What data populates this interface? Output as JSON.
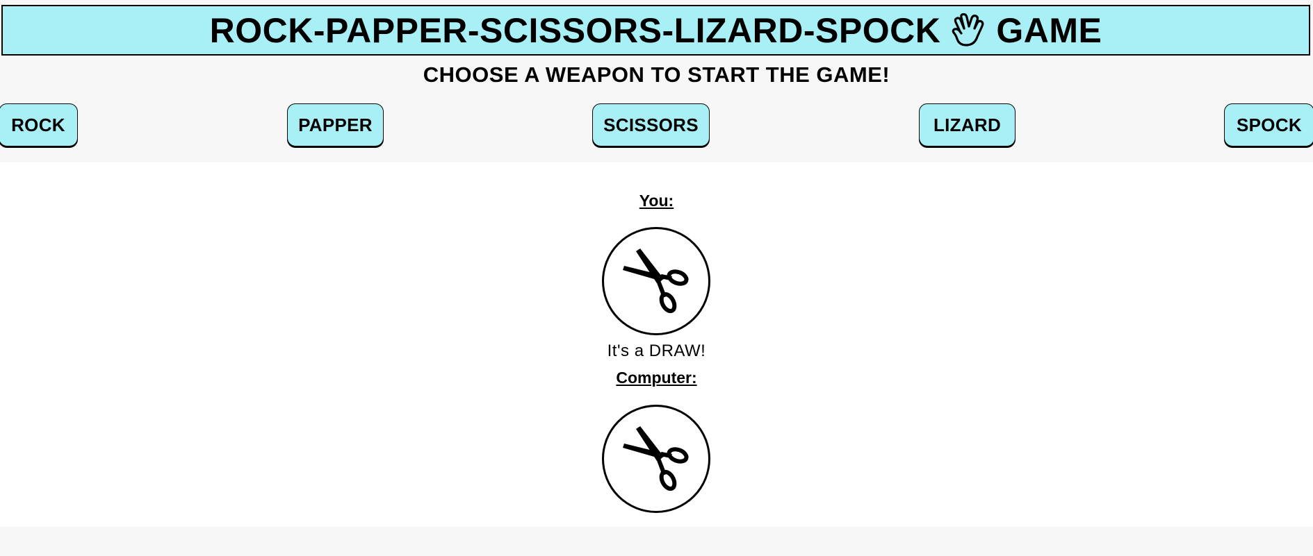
{
  "header": {
    "title": "ROCK-PAPPER-SCISSORS-LIZARD-SPOCK",
    "icon": "spock-hand-icon",
    "suffix": "GAME",
    "background": "#a8f0f5"
  },
  "subtitle": "CHOOSE A WEAPON TO START THE GAME!",
  "weapons": [
    {
      "label": "ROCK"
    },
    {
      "label": "PAPPER"
    },
    {
      "label": "SCISSORS"
    },
    {
      "label": "LIZARD"
    },
    {
      "label": "SPOCK"
    }
  ],
  "game": {
    "player_label": "You:",
    "player_choice_icon": "scissors-icon",
    "result": "It's a DRAW!",
    "computer_label": "Computer:",
    "computer_choice_icon": "scissors-icon"
  }
}
